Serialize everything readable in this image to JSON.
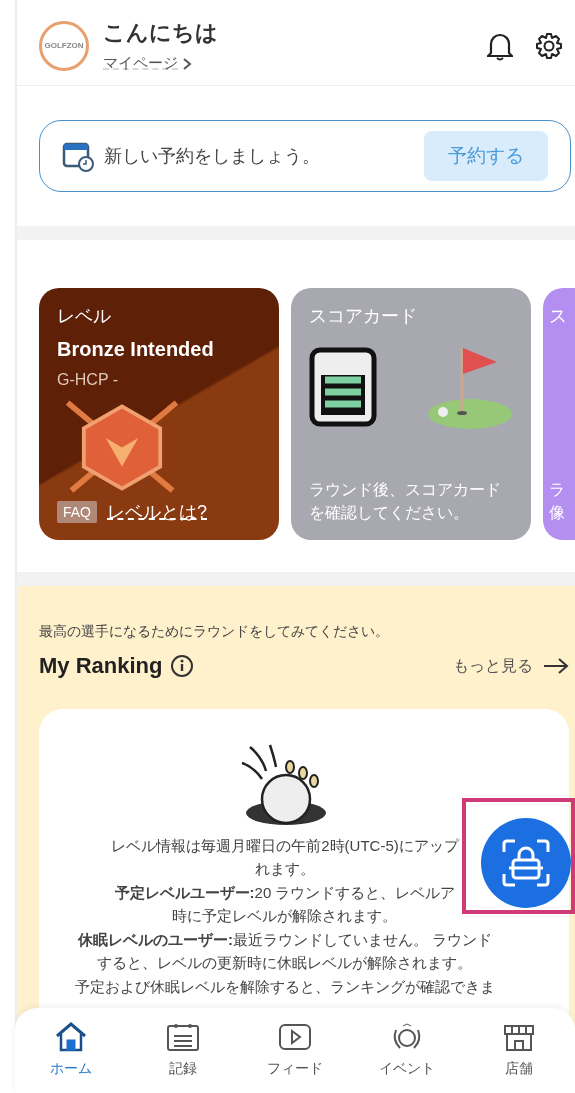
{
  "header": {
    "greeting": "こんにちは",
    "mypage_link": "マイページ",
    "logo_text": "GOLFZON"
  },
  "booking": {
    "message": "新しい予約をしましょう。",
    "button": "予約する"
  },
  "cards": [
    {
      "kind": "level",
      "title": "レベル",
      "level_name": "Bronze Intended",
      "handicap": "G-HCP -",
      "faq_badge": "FAQ",
      "faq_link": "レベルとは?"
    },
    {
      "kind": "scorecard",
      "title": "スコアカード",
      "description": "ラウンド後、スコアカードを確認してください。"
    },
    {
      "kind": "partial",
      "title": "ス",
      "description_lines": [
        "ラ",
        "像"
      ]
    }
  ],
  "ranking": {
    "intro": "最高の選手になるためにラウンドをしてみてください。",
    "title": "My Ranking",
    "more_link": "もっと見る",
    "notes": [
      {
        "lines": [
          "レベル情報は毎週月曜日の午前2時(UTC-5)にアップ",
          "れます。"
        ]
      },
      {
        "lines": [
          "**予定レベルユーザー:**20 ラウンドすると、レベルア",
          "時に予定レベルが解除されます。"
        ]
      },
      {
        "lines": [
          "**休眠レベルのユーザー:**最近ラウンドしていません。 ラウンド",
          "すると、レベルの更新時に休眠レベルが解除されます。"
        ]
      },
      {
        "lines": [
          "予定および休眠レベルを解除すると、ランキングが確認できま"
        ]
      }
    ]
  },
  "nav": [
    {
      "label": "ホーム",
      "selected": true
    },
    {
      "label": "記録",
      "selected": false
    },
    {
      "label": "フィード",
      "selected": false
    },
    {
      "label": "イベント",
      "selected": false
    },
    {
      "label": "店舗",
      "selected": false
    }
  ]
}
